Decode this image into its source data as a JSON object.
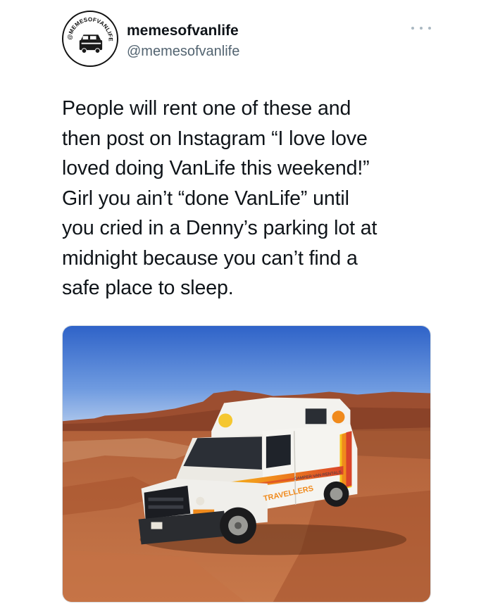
{
  "author": {
    "display_name": "memesofvanlife",
    "handle": "@memesofvanlife",
    "avatar_ring_text": "@MEMESOFVANLIFE"
  },
  "tweet": {
    "text_lines": [
      "People will rent one of these and",
      "then post on Instagram “I love love",
      "loved doing VanLife this weekend!”",
      "Girl you ain’t “done VanLife” until",
      "you cried in a Denny’s parking lot at",
      "midnight because you can’t find a",
      "safe place to sleep."
    ]
  },
  "media": {
    "decal_brand": "TRAVELLERS",
    "decal_subtitle": "CAMPER VAN RENTALS"
  },
  "icons": {
    "more": "more-options-icon"
  },
  "colors": {
    "text": "#0f1419",
    "secondary": "#536471",
    "sky_top": "#3d6fd0",
    "desert": "#b5643a",
    "stripe_orange": "#f08a1c",
    "stripe_yellow": "#f5c21b",
    "stripe_red": "#d9442a"
  }
}
